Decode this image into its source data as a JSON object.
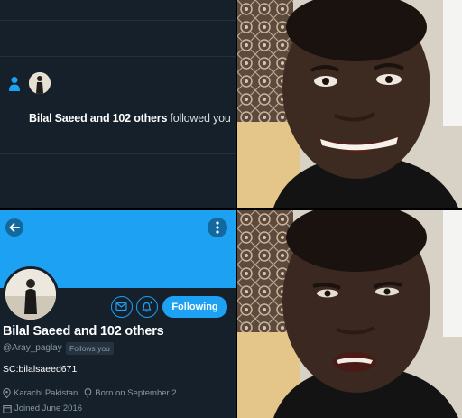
{
  "notification": {
    "actor": "Bilal Saeed",
    "suffix": "and 102 others",
    "action": "followed you"
  },
  "profile": {
    "display_name": "Bilal Saeed and 102 others",
    "handle": "@Aray_paglay",
    "follows_you_badge": "Follows you",
    "bio": "SC:bilalsaeed671",
    "location": "Karachi Pakistan",
    "birthday": "Born on September 2",
    "joined": "Joined June 2016",
    "following_button_label": "Following"
  },
  "reaction_panels": [
    {
      "expression": "smiling"
    },
    {
      "expression": "disappointed"
    }
  ],
  "colors": {
    "background": "#15202b",
    "accent": "#1da1f2",
    "text_primary": "#ffffff",
    "text_secondary": "#8899a6"
  },
  "icons": {
    "notification": "person-follow-icon",
    "back": "arrow-left-icon",
    "more": "more-vertical-icon",
    "message": "mail-icon",
    "notify": "bell-plus-icon",
    "location": "location-pin-icon",
    "birthday": "balloon-icon",
    "joined": "calendar-icon"
  }
}
